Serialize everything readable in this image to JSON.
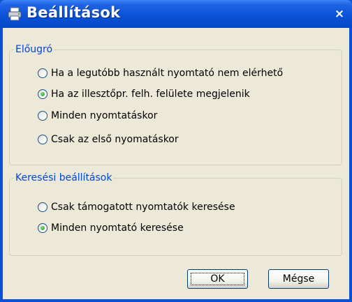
{
  "window": {
    "title": "Beállítások",
    "close_symbol": "×",
    "title_icon": "printer-icon"
  },
  "popup_group": {
    "legend": "Előugró",
    "options": [
      {
        "label": "Ha a legutóbb használt nyomtató nem elérhető",
        "selected": false
      },
      {
        "label": "Ha az illesztőpr. felh. felülete megjelenik",
        "selected": true
      },
      {
        "label": "Minden nyomtatáskor",
        "selected": false
      },
      {
        "label": "Csak az első nyomatáskor",
        "selected": false
      }
    ]
  },
  "search_group": {
    "legend": "Keresési beállítások",
    "options": [
      {
        "label": "Csak támogatott nyomtatók keresése",
        "selected": false
      },
      {
        "label": "Minden nyomtató keresése",
        "selected": true
      }
    ]
  },
  "buttons": {
    "ok": "OK",
    "cancel": "Mégse"
  },
  "colors": {
    "titlebar": "#0a52d8",
    "dialog_bg": "#ece9d8",
    "legend_text": "#0046d5"
  }
}
